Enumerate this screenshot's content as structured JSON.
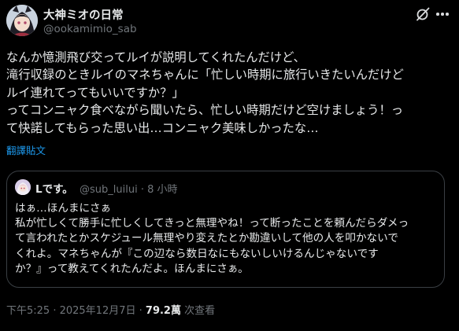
{
  "author": {
    "display_name": "大神ミオの日常",
    "handle": "@ookamimio_sab"
  },
  "post": {
    "lines": [
      "なんか憶測飛び交ってルイが説明してくれたんだけど、",
      "滝行収録のときルイのマネちゃんに「忙しい時期に旅行いきたいんだけど",
      "ルイ連れてってもいいですか？」",
      "ってコンニャク食べながら聞いたら、忙しい時期だけど空けましょう！っ",
      "て快諾してもらった思い出…コンニャク美味しかったな…"
    ],
    "translate_label": "翻譯貼文"
  },
  "quote": {
    "display_name": "Lです。",
    "handle": "@sub_luilui",
    "separator": "·",
    "time": "8 小時",
    "lines": [
      "はぁ…ほんまにさぁ",
      "私が忙しくて勝手に忙しくしてきっと無理やね！って断ったことを頼んだらダメっ",
      "て言われたとかスケジュール無理やり変えたとか勘違いして他の人を叩かないで",
      "くれよ。マネちゃんが『この辺なら数日なにもないしいけるんじゃないです",
      "か？』って教えてくれたんだよ。ほんまにさぁ。"
    ]
  },
  "footer": {
    "timestamp": "下午5:25 · 2025年12月7日 ·",
    "views_count": "79.2萬",
    "views_label": "次查看"
  },
  "icons": {
    "grok": "grok-icon",
    "more": "more-options-icon"
  },
  "colors": {
    "background": "#000000",
    "text": "#e7e9ea",
    "secondary": "#71767b",
    "link": "#1d9bf0",
    "border": "#3a3f44"
  }
}
